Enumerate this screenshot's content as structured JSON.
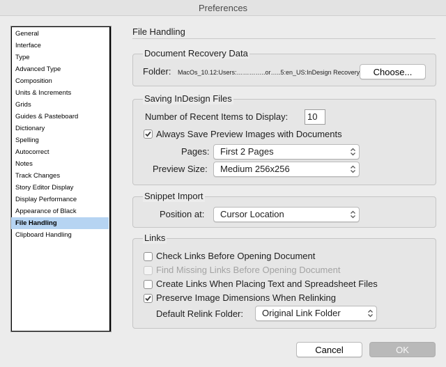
{
  "window": {
    "title": "Preferences"
  },
  "sidebar": {
    "items": [
      {
        "label": "General"
      },
      {
        "label": "Interface"
      },
      {
        "label": "Type"
      },
      {
        "label": "Advanced Type"
      },
      {
        "label": "Composition"
      },
      {
        "label": "Units & Increments"
      },
      {
        "label": "Grids"
      },
      {
        "label": "Guides & Pasteboard"
      },
      {
        "label": "Dictionary"
      },
      {
        "label": "Spelling"
      },
      {
        "label": "Autocorrect"
      },
      {
        "label": "Notes"
      },
      {
        "label": "Track Changes"
      },
      {
        "label": "Story Editor Display"
      },
      {
        "label": "Display Performance"
      },
      {
        "label": "Appearance of Black"
      },
      {
        "label": "File Handling"
      },
      {
        "label": "Clipboard Handling"
      }
    ],
    "selected": "File Handling"
  },
  "panel": {
    "title": "File Handling"
  },
  "recovery": {
    "title": "Document Recovery Data",
    "folder_label": "Folder:",
    "folder_path": "MacOs_10.12:Users:…………..or…..5:en_US:InDesign Recovery",
    "choose_label": "Choose..."
  },
  "saving": {
    "title": "Saving InDesign Files",
    "recent_label": "Number of Recent Items to Display:",
    "recent_value": "10",
    "save_preview_label": "Always Save Preview Images with Documents",
    "save_preview_checked": true,
    "pages_label": "Pages:",
    "pages_value": "First 2 Pages",
    "preview_size_label": "Preview Size:",
    "preview_size_value": "Medium 256x256"
  },
  "snippet": {
    "title": "Snippet Import",
    "position_label": "Position at:",
    "position_value": "Cursor Location"
  },
  "links": {
    "title": "Links",
    "check_links_label": "Check Links Before Opening Document",
    "find_missing_label": "Find Missing Links Before Opening Document",
    "create_links_label": "Create Links When Placing Text and Spreadsheet Files",
    "preserve_dims_label": "Preserve Image Dimensions When Relinking",
    "relink_folder_label": "Default Relink Folder:",
    "relink_folder_value": "Original Link Folder"
  },
  "footer": {
    "cancel_label": "Cancel",
    "ok_label": "OK"
  }
}
